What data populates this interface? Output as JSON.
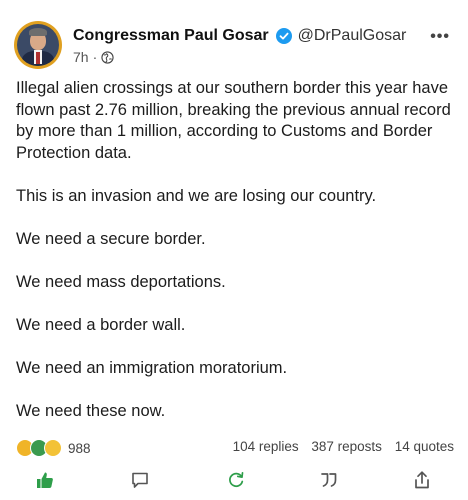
{
  "author": {
    "display_name": "Congressman Paul Gosar",
    "handle": "@DrPaulGosar",
    "timestamp": "7h",
    "separator": "·",
    "verified": true,
    "audience_icon": "globe-icon"
  },
  "post": {
    "paragraphs": [
      "Illegal alien crossings at our southern border this year have flown past 2.76 million, breaking the previous annual record by more than 1 million, according to Customs and Border Protection data.",
      "This is an invasion and we are losing our country.",
      "We need a secure border.",
      "We need mass deportations.",
      "We need a border wall.",
      "We need an immigration moratorium.",
      "We need these now."
    ]
  },
  "stats": {
    "reaction_icons": [
      "thumbs-up-icon",
      "sad-face-icon",
      "laughing-face-icon"
    ],
    "reaction_count": "988",
    "replies": "104 replies",
    "reposts": "387 reposts",
    "quotes": "14 quotes"
  },
  "actions": [
    "like-icon",
    "comment-icon",
    "repost-icon",
    "quote-icon",
    "share-icon"
  ],
  "colors": {
    "verified_blue": "#1d9bf0",
    "like_green": "#2e9e4a",
    "action_gray": "#555555",
    "repost_green": "#2e9e4a"
  }
}
